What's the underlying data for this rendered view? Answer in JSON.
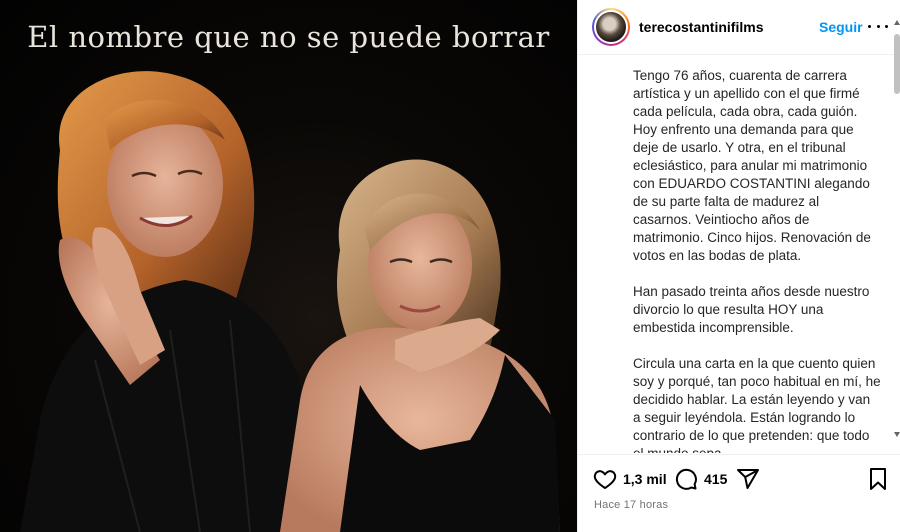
{
  "media": {
    "title": "El nombre que no se puede borrar"
  },
  "post": {
    "username": "terecostantinifilms",
    "follow_label": "Seguir",
    "caption": [
      "Tengo 76 años, cuarenta de carrera artística y un apellido con el que firmé cada película, cada obra, cada guión. Hoy enfrento una demanda para que deje de usarlo. Y otra, en el tribunal eclesiástico, para anular mi matrimonio con EDUARDO COSTANTINI alegando de su parte falta de madurez al casarnos. Veintiocho años de matrimonio. Cinco hijos. Renovación de votos en las bodas de plata.",
      "Han pasado treinta años desde nuestro divorcio lo que resulta HOY una embestida incomprensible.",
      "Circula una carta en la que cuento quien soy y porqué, tan poco habitual en mí, he decidido hablar. La están leyendo y van a seguir leyéndola. Están logrando lo contrario de lo que pretenden: que todo el mundo sepa"
    ],
    "likes": "1,3 mil",
    "comments": "415",
    "time_ago": "Hace 17 horas"
  },
  "icons": {
    "like": "heart-icon",
    "comment": "comment-icon",
    "share": "send-icon",
    "save": "bookmark-icon",
    "more": "more-options-icon"
  },
  "colors": {
    "link_blue": "#0095f6",
    "text": "#262626",
    "muted": "#737373"
  }
}
